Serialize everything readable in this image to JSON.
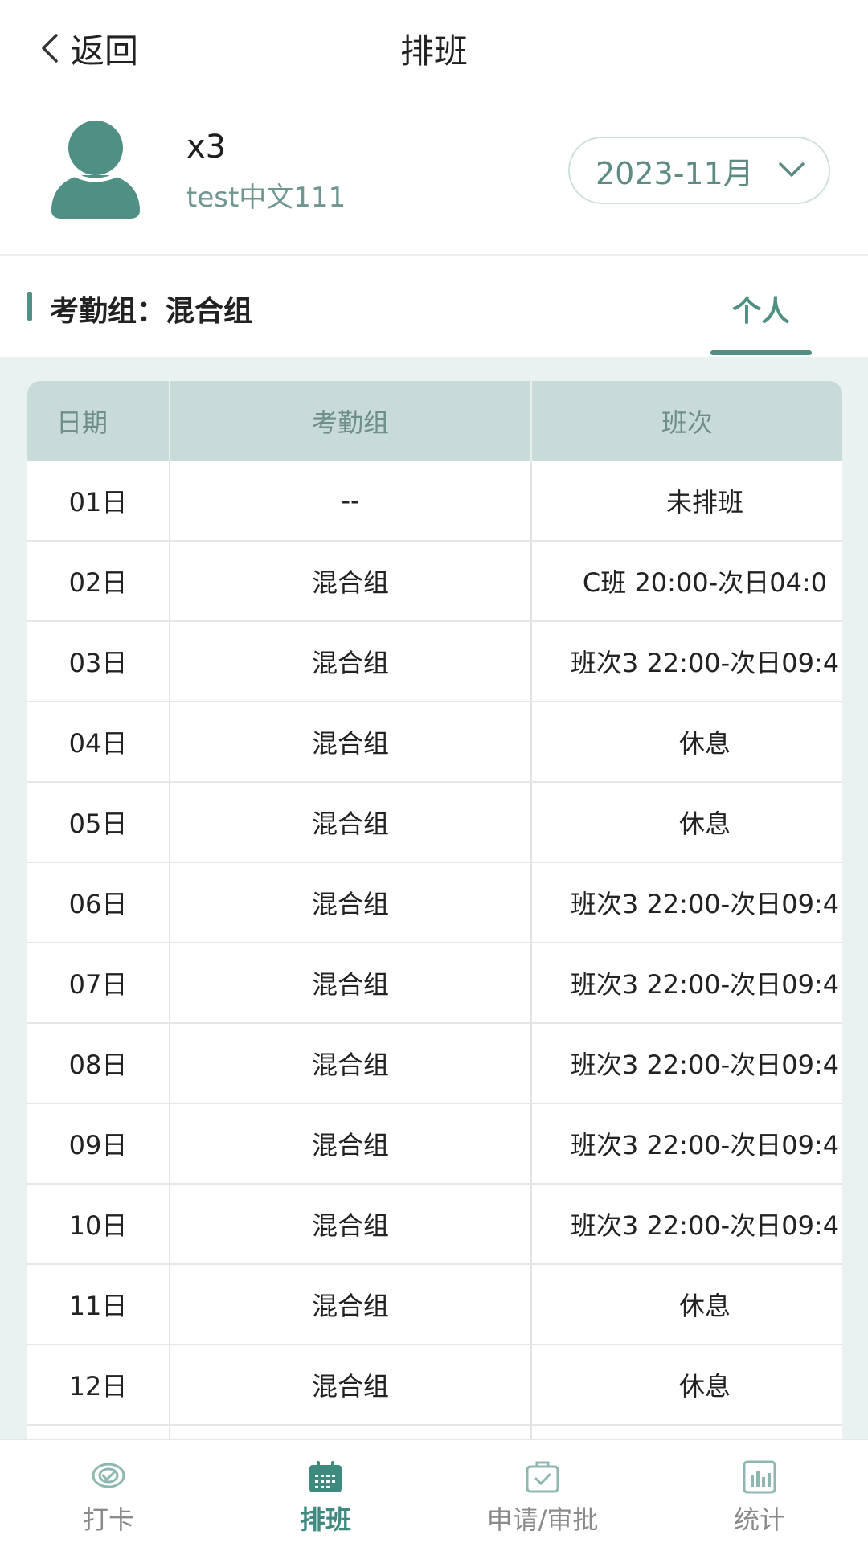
{
  "header": {
    "back_label": "返回",
    "title": "排班"
  },
  "profile": {
    "name": "x3",
    "subtitle": "test中文111",
    "month": "2023-11月"
  },
  "group": {
    "label": "考勤组：混合组",
    "tab_label": "个人"
  },
  "table": {
    "headers": [
      "日期",
      "考勤组",
      "班次"
    ],
    "rows": [
      {
        "date": "01日",
        "group": "--",
        "shift": "未排班"
      },
      {
        "date": "02日",
        "group": "混合组",
        "shift": "C班 20:00-次日04:0"
      },
      {
        "date": "03日",
        "group": "混合组",
        "shift": "班次3 22:00-次日09:4"
      },
      {
        "date": "04日",
        "group": "混合组",
        "shift": "休息"
      },
      {
        "date": "05日",
        "group": "混合组",
        "shift": "休息"
      },
      {
        "date": "06日",
        "group": "混合组",
        "shift": "班次3 22:00-次日09:4"
      },
      {
        "date": "07日",
        "group": "混合组",
        "shift": "班次3 22:00-次日09:4"
      },
      {
        "date": "08日",
        "group": "混合组",
        "shift": "班次3 22:00-次日09:4"
      },
      {
        "date": "09日",
        "group": "混合组",
        "shift": "班次3 22:00-次日09:4"
      },
      {
        "date": "10日",
        "group": "混合组",
        "shift": "班次3 22:00-次日09:4"
      },
      {
        "date": "11日",
        "group": "混合组",
        "shift": "休息"
      },
      {
        "date": "12日",
        "group": "混合组",
        "shift": "休息"
      },
      {
        "date": "",
        "group": "",
        "shift": ""
      }
    ]
  },
  "nav": {
    "items": [
      {
        "label": "打卡",
        "icon": "checkin-icon",
        "active": false
      },
      {
        "label": "排班",
        "icon": "calendar-icon",
        "active": true
      },
      {
        "label": "申请/审批",
        "icon": "approval-icon",
        "active": false
      },
      {
        "label": "统计",
        "icon": "chart-icon",
        "active": false
      }
    ]
  },
  "colors": {
    "accent": "#4f8f84",
    "table_header_bg": "#c9dbd8",
    "content_bg": "#e9f2f1"
  }
}
